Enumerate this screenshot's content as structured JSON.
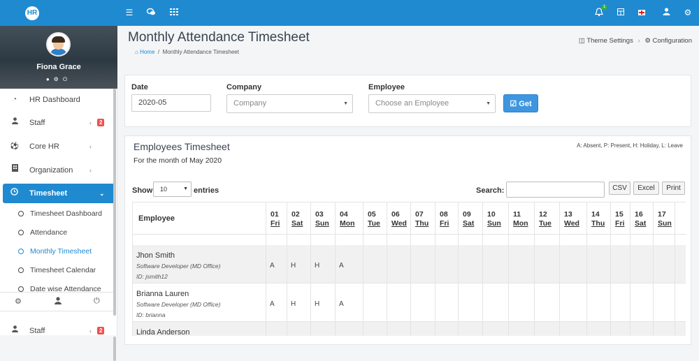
{
  "topbar": {
    "logo": "HR",
    "left_icons": [
      "menu-icon",
      "chat-icon",
      "grid-icon"
    ],
    "notification_count": "1",
    "right_icons": [
      "bell-icon",
      "apps-icon",
      "flag-icon",
      "user-icon",
      "gear-icon"
    ],
    "accent_color": "#1f8ad0"
  },
  "sidebar": {
    "profile_name": "Fiona Grace",
    "items": [
      {
        "label": "HR Dashboard",
        "icon": "dashboard-icon"
      },
      {
        "label": "Staff",
        "icon": "user-icon",
        "arrow": "‹",
        "badge": "2"
      },
      {
        "label": "Core HR",
        "icon": "soccer-icon",
        "arrow": "‹"
      },
      {
        "label": "Organization",
        "icon": "building-icon",
        "arrow": "‹"
      },
      {
        "label": "Timesheet",
        "icon": "clock-icon",
        "arrow": "⌄"
      }
    ],
    "subitems": [
      {
        "label": "Timesheet Dashboard"
      },
      {
        "label": "Attendance"
      },
      {
        "label": "Monthly Timesheet"
      },
      {
        "label": "Timesheet Calendar"
      },
      {
        "label": "Date wise Attendance"
      }
    ],
    "bottom_item": {
      "label": "Staff",
      "arrow": "‹",
      "badge": "2"
    }
  },
  "header": {
    "title": "Monthly Attendance Timesheet",
    "breadcrumb_home": "Home",
    "breadcrumb_sep": "/",
    "breadcrumb_current": "Monthly Attendance Timesheet",
    "theme_settings": "Theme Settings",
    "configuration": "Configuration"
  },
  "filter": {
    "date_label": "Date",
    "date_value": "2020-05",
    "company_label": "Company",
    "company_placeholder": "Company",
    "employee_label": "Employee",
    "employee_placeholder": "Choose an Employee",
    "get_button": "Get"
  },
  "timesheet": {
    "title": "Employees Timesheet",
    "subtitle": "For the month of May 2020",
    "legend": "A: Absent, P: Present, H: Holiday, L: Leave",
    "show_label": "Show",
    "page_length": "10",
    "entries_label": "entries",
    "search_label": "Search:",
    "buttons": [
      "CSV",
      "Excel",
      "Print"
    ],
    "employee_header": "Employee",
    "days": [
      {
        "d": "01",
        "w": "Fri"
      },
      {
        "d": "02",
        "w": "Sat"
      },
      {
        "d": "03",
        "w": "Sun"
      },
      {
        "d": "04",
        "w": "Mon"
      },
      {
        "d": "05",
        "w": "Tue"
      },
      {
        "d": "06",
        "w": "Wed"
      },
      {
        "d": "07",
        "w": "Thu"
      },
      {
        "d": "08",
        "w": "Fri"
      },
      {
        "d": "09",
        "w": "Sat"
      },
      {
        "d": "10",
        "w": "Sun"
      },
      {
        "d": "11",
        "w": "Mon"
      },
      {
        "d": "12",
        "w": "Tue"
      },
      {
        "d": "13",
        "w": "Wed"
      },
      {
        "d": "14",
        "w": "Thu"
      },
      {
        "d": "15",
        "w": "Fri"
      },
      {
        "d": "16",
        "w": "Sat"
      },
      {
        "d": "17",
        "w": "Sun"
      }
    ],
    "rows": [
      {
        "name": "Jhon Smith",
        "role": "Software Developer (MD Office)",
        "id": "ID: jsmith12",
        "marks": [
          "A",
          "H",
          "H",
          "A"
        ]
      },
      {
        "name": "Brianna Lauren",
        "role": "Software Developer (MD Office)",
        "id": "ID: brianna",
        "marks": [
          "A",
          "H",
          "H",
          "A"
        ]
      },
      {
        "name": "Linda Anderson",
        "role": "",
        "id": "",
        "marks": []
      }
    ]
  }
}
